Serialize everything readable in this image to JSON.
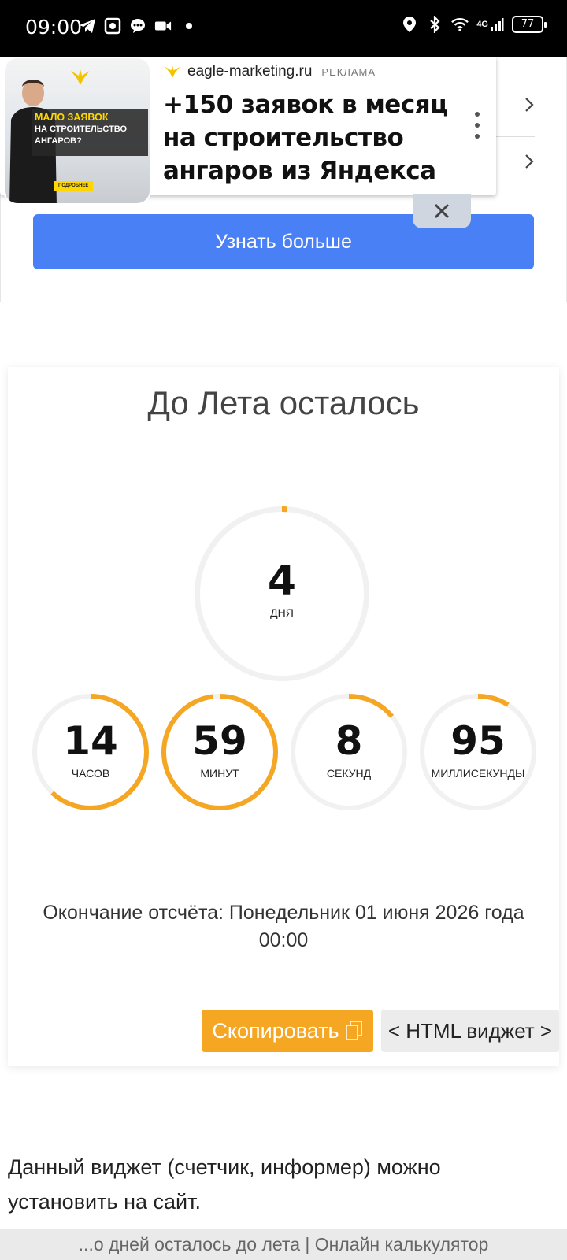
{
  "status_bar": {
    "time": "09:00",
    "network": "4G",
    "battery": "77",
    "icons_left": [
      "telegram-icon",
      "gallery-icon",
      "chat-icon",
      "video-icon",
      "dot-icon"
    ],
    "icons_right": [
      "location-icon",
      "bluetooth-icon",
      "wifi-icon",
      "signal-icon",
      "battery-icon"
    ]
  },
  "ad": {
    "domain": "eagle-marketing.ru",
    "label": "РЕКЛАМА",
    "title": "+150 заявок в месяц на строительство ангаров из Яндекса",
    "image_banner_line1": "МАЛО ЗАЯВОК",
    "image_banner_line2": "НА СТРОИТЕЛЬСТВО АНГАРОВ?",
    "image_more": "ПОДРОБНЕЕ",
    "cta": "Узнать больше",
    "colors": {
      "cta": "#4a80f6",
      "logo": "#f3c300"
    }
  },
  "countdown": {
    "title": "До Лета осталось",
    "units": [
      {
        "value": "4",
        "label": "ДНЯ",
        "progress": 0.01
      },
      {
        "value": "14",
        "label": "ЧАСОВ",
        "progress": 0.62
      },
      {
        "value": "59",
        "label": "МИНУТ",
        "progress": 0.98
      },
      {
        "value": "8",
        "label": "СЕКУНД",
        "progress": 0.14
      },
      {
        "value": "95",
        "label": "МИЛЛИСЕКУНДЫ",
        "progress": 0.09
      }
    ],
    "end_text_line1": "Окончание отсчёта: Понедельник 01 июня 2026 года",
    "end_text_line2": "00:00",
    "copy_button": "Скопировать",
    "html_button": "< HTML виджет >",
    "colors": {
      "accent": "#f5a623",
      "track": "#f1f1f1"
    }
  },
  "widget_description": "Данный виджет (счетчик, информер) можно установить на сайт.",
  "footer_title": "...о дней осталось до лета | Онлайн калькулятор"
}
